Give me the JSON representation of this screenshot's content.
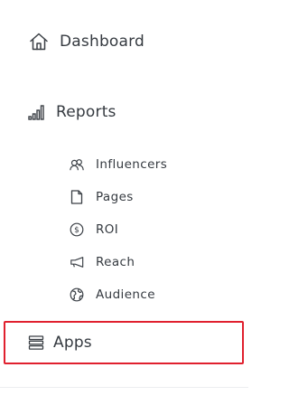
{
  "nav": {
    "dashboard": {
      "label": "Dashboard",
      "icon": "home-icon"
    },
    "reports": {
      "label": "Reports",
      "icon": "bar-chart-icon"
    },
    "report_items": [
      {
        "label": "Influencers",
        "icon": "people-icon"
      },
      {
        "label": "Pages",
        "icon": "page-icon"
      },
      {
        "label": "ROI",
        "icon": "dollar-icon"
      },
      {
        "label": "Reach",
        "icon": "megaphone-icon"
      },
      {
        "label": "Audience",
        "icon": "globe-icon"
      }
    ],
    "apps": {
      "label": "Apps",
      "icon": "stack-icon",
      "highlighted": true
    }
  },
  "colors": {
    "text": "#353a40",
    "highlight_border": "#e0202e"
  }
}
